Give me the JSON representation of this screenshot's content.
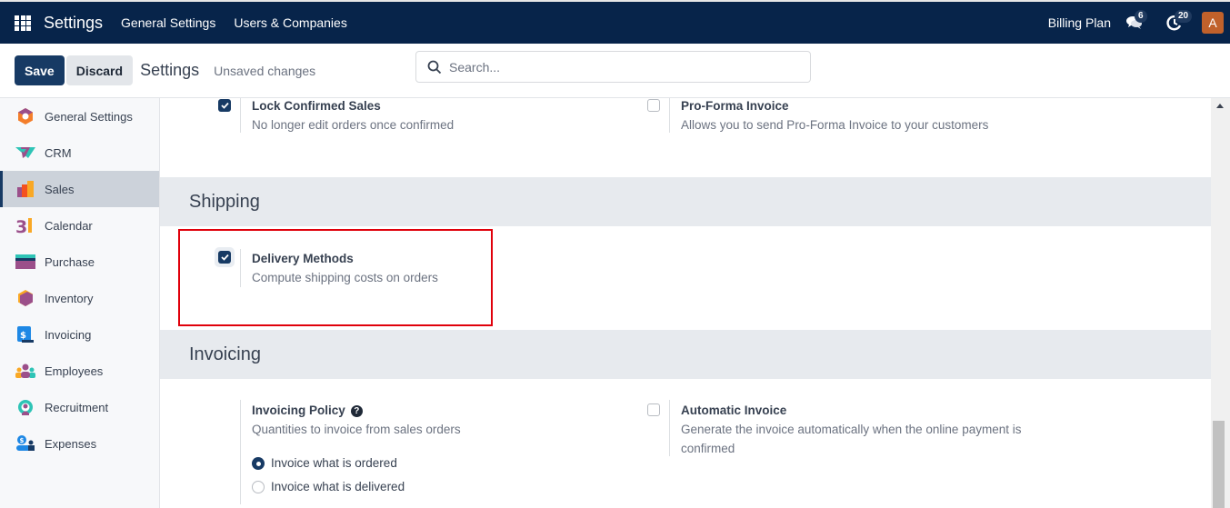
{
  "navbar": {
    "app_title": "Settings",
    "menu": [
      "General Settings",
      "Users & Companies"
    ],
    "billing_label": "Billing Plan",
    "messages_count": "6",
    "activities_count": "20",
    "avatar_letter": "A",
    "avatar_color": "#c0612b",
    "bg_color": "#07244a"
  },
  "control_panel": {
    "save_label": "Save",
    "discard_label": "Discard",
    "title": "Settings",
    "status": "Unsaved changes",
    "search_placeholder": "Search..."
  },
  "sidebar": {
    "items": [
      {
        "label": "General Settings",
        "icon": "general-settings-icon",
        "active": false
      },
      {
        "label": "CRM",
        "icon": "crm-icon",
        "active": false
      },
      {
        "label": "Sales",
        "icon": "sales-icon",
        "active": true
      },
      {
        "label": "Calendar",
        "icon": "calendar-icon",
        "active": false
      },
      {
        "label": "Purchase",
        "icon": "purchase-icon",
        "active": false
      },
      {
        "label": "Inventory",
        "icon": "inventory-icon",
        "active": false
      },
      {
        "label": "Invoicing",
        "icon": "invoicing-icon",
        "active": false
      },
      {
        "label": "Employees",
        "icon": "employees-icon",
        "active": false
      },
      {
        "label": "Recruitment",
        "icon": "recruitment-icon",
        "active": false
      },
      {
        "label": "Expenses",
        "icon": "expenses-icon",
        "active": false
      }
    ]
  },
  "content": {
    "top_settings": [
      {
        "title": "Lock Confirmed Sales",
        "description": "No longer edit orders once confirmed",
        "checked": true
      },
      {
        "title": "Pro-Forma Invoice",
        "description": "Allows you to send Pro-Forma Invoice to your customers",
        "checked": false
      }
    ],
    "shipping": {
      "heading": "Shipping",
      "settings": [
        {
          "title": "Delivery Methods",
          "description": "Compute shipping costs on orders",
          "checked": true,
          "highlighted": true
        }
      ]
    },
    "invoicing": {
      "heading": "Invoicing",
      "policy": {
        "title": "Invoicing Policy",
        "help": "?",
        "description": "Quantities to invoice from sales orders",
        "options": [
          {
            "label": "Invoice what is ordered",
            "selected": true
          },
          {
            "label": "Invoice what is delivered",
            "selected": false
          }
        ]
      },
      "automatic_invoice": {
        "title": "Automatic Invoice",
        "description": "Generate the invoice automatically when the online payment is confirmed",
        "checked": false
      }
    }
  }
}
